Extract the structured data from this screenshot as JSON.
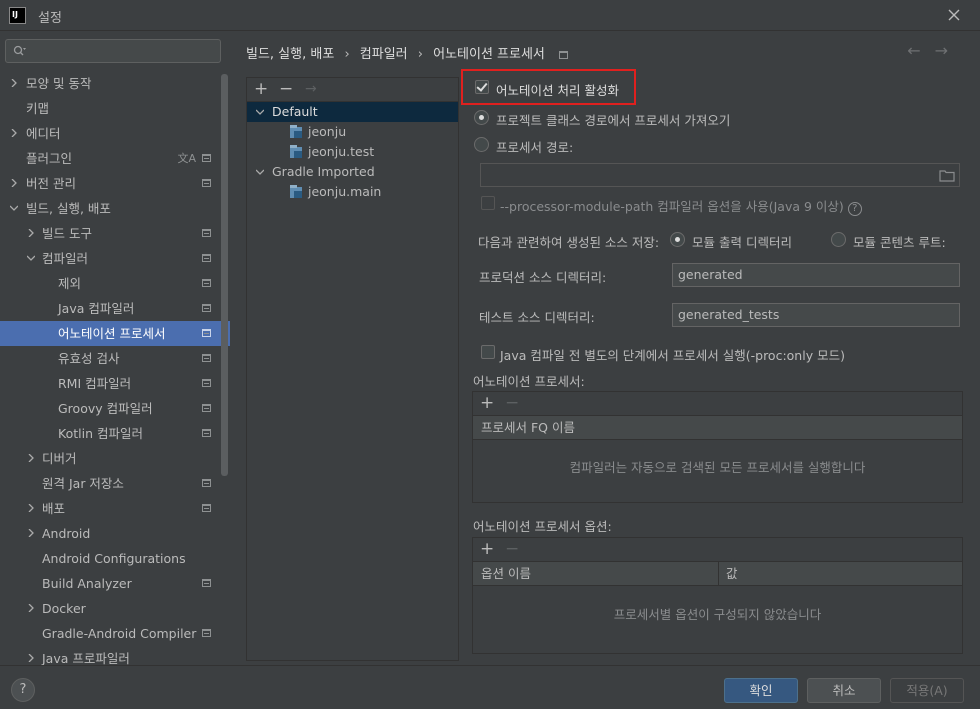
{
  "window": {
    "title": "설정",
    "app_icon_text": "IJ"
  },
  "search": {
    "placeholder": ""
  },
  "sidebar": {
    "items": [
      {
        "label": "모양 및 동작"
      },
      {
        "label": "키맵"
      },
      {
        "label": "에디터"
      },
      {
        "label": "플러그인"
      },
      {
        "label": "버전 관리"
      },
      {
        "label": "빌드, 실행, 배포"
      },
      {
        "label": "빌드 도구"
      },
      {
        "label": "컴파일러"
      },
      {
        "label": "제외"
      },
      {
        "label": "Java 컴파일러"
      },
      {
        "label": "어노테이션 프로세서"
      },
      {
        "label": "유효성 검사"
      },
      {
        "label": "RMI 컴파일러"
      },
      {
        "label": "Groovy 컴파일러"
      },
      {
        "label": "Kotlin 컴파일러"
      },
      {
        "label": "디버거"
      },
      {
        "label": "원격 Jar 저장소"
      },
      {
        "label": "배포"
      },
      {
        "label": "Android"
      },
      {
        "label": "Android Configurations"
      },
      {
        "label": "Build Analyzer"
      },
      {
        "label": "Docker"
      },
      {
        "label": "Gradle-Android Compiler"
      },
      {
        "label": "Java 프로파일러"
      }
    ],
    "translate_glyph": "文A"
  },
  "breadcrumb": {
    "parts": [
      "빌드, 실행, 배포",
      "컴파일러",
      "어노테이션 프로세서"
    ],
    "separator": "›"
  },
  "nav": {
    "back": "←",
    "forward": "→"
  },
  "profiles": {
    "toolbar": {
      "add": "+",
      "remove": "−",
      "move": "→"
    },
    "items": [
      {
        "label": "Default"
      },
      {
        "label": "jeonju"
      },
      {
        "label": "jeonju.test"
      },
      {
        "label": "Gradle Imported"
      },
      {
        "label": "jeonju.main"
      }
    ]
  },
  "settings": {
    "enable_label": "어노테이션 처리 활성화",
    "enable_checked": true,
    "from_classpath_label": "프로젝트 클래스 경로에서 프로세서 가져오기",
    "processor_path_label": "프로세서 경로:",
    "processor_path_value": "",
    "module_path_label": "--processor-module-path 컴파일러 옵션을 사용(Java 9 이상)",
    "help_glyph": "?",
    "store_label": "다음과 관련하여 생성된 소스 저장:",
    "store_module_output": "모듈 출력 디렉터리",
    "store_content_root": "모듈 콘텐츠 루트:",
    "prod_dir_label": "프로덕션 소스 디렉터리:",
    "prod_dir_value": "generated",
    "test_dir_label": "테스트 소스 디렉터리:",
    "test_dir_value": "generated_tests",
    "proc_only_label": "Java 컴파일 전 별도의 단계에서 프로세서 실행(-proc:only 모드)",
    "processors_section": "어노테이션 프로세서:",
    "processors_col": "프로세서 FQ 이름",
    "processors_empty": "컴파일러는 자동으로 검색된 모든 프로세서를 실행합니다",
    "options_section": "어노테이션 프로세서 옵션:",
    "options_col_name": "옵션 이름",
    "options_col_value": "값",
    "options_empty": "프로세서별 옵션이 구성되지 않았습니다",
    "add": "+",
    "remove": "−"
  },
  "footer": {
    "help": "?",
    "ok": "확인",
    "cancel": "취소",
    "apply": "적용(A)"
  },
  "colors": {
    "background": "#3c3f41",
    "selection": "#4b6eaf",
    "primary_button": "#365880",
    "highlight_border": "#e0201e"
  }
}
